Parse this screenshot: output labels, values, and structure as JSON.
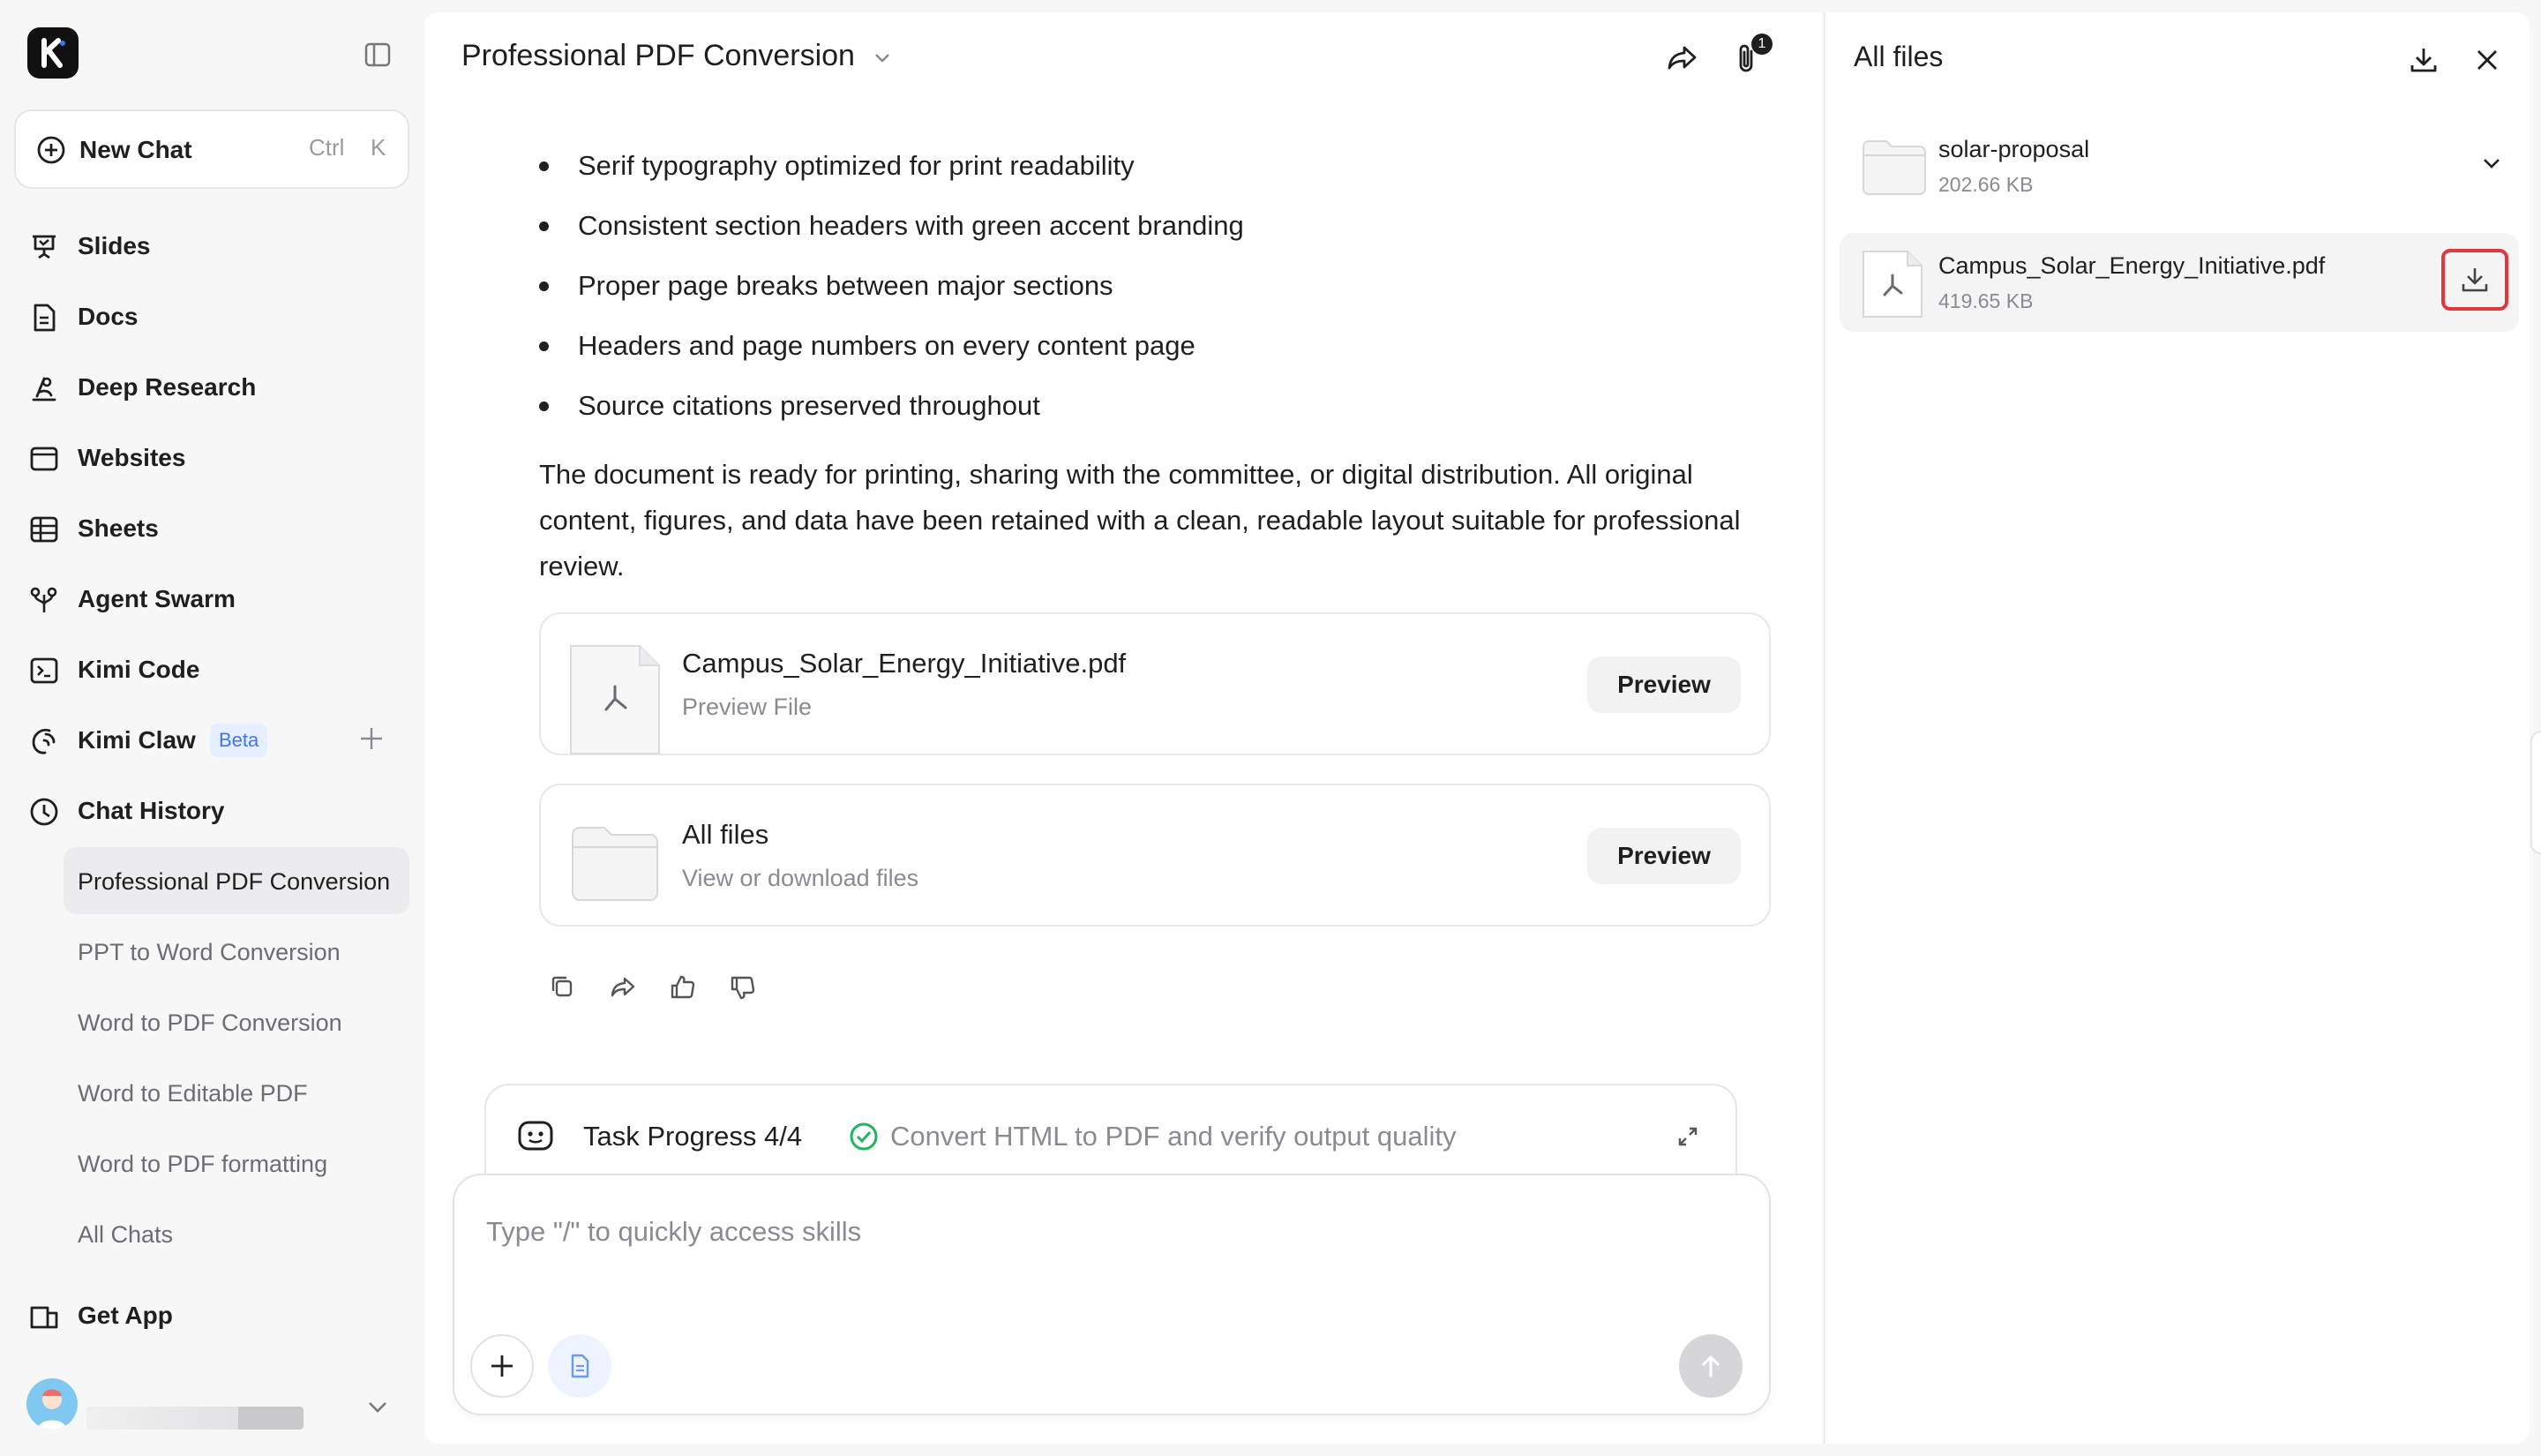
{
  "sidebar": {
    "new_chat": {
      "label": "New Chat",
      "shortcut_ctrl": "Ctrl",
      "shortcut_key": "K"
    },
    "nav": [
      {
        "label": "Slides",
        "icon": "slides-icon"
      },
      {
        "label": "Docs",
        "icon": "docs-icon"
      },
      {
        "label": "Deep Research",
        "icon": "deep-research-icon"
      },
      {
        "label": "Websites",
        "icon": "websites-icon"
      },
      {
        "label": "Sheets",
        "icon": "sheets-icon"
      },
      {
        "label": "Agent Swarm",
        "icon": "agent-swarm-icon"
      },
      {
        "label": "Kimi Code",
        "icon": "kimi-code-icon"
      },
      {
        "label": "Kimi Claw",
        "icon": "kimi-claw-icon",
        "badge": "Beta"
      },
      {
        "label": "Chat History",
        "icon": "clock-icon"
      }
    ],
    "history": [
      {
        "label": "Professional PDF Conversion",
        "active": true
      },
      {
        "label": "PPT to Word Conversion"
      },
      {
        "label": "Word to PDF Conversion"
      },
      {
        "label": "Word to Editable PDF"
      },
      {
        "label": "Word to PDF formatting"
      },
      {
        "label": "All Chats"
      }
    ],
    "get_app": "Get App"
  },
  "main": {
    "title": "Professional PDF Conversion",
    "attachment_count": "1",
    "bullets": [
      "Serif typography optimized for print readability",
      "Consistent section headers with green accent branding",
      "Proper page breaks between major sections",
      "Headers and page numbers on every content page",
      "Source citations preserved throughout"
    ],
    "paragraph": "The document is ready for printing, sharing with the committee, or digital distribution. All original content, figures, and data have been retained with a clean, readable layout suitable for professional review.",
    "cards": [
      {
        "name": "Campus_Solar_Energy_Initiative.pdf",
        "sub": "Preview File",
        "button": "Preview"
      },
      {
        "name": "All files",
        "sub": "View or download files",
        "button": "Preview"
      }
    ],
    "task_progress": {
      "label": "Task Progress 4/4",
      "status": "Convert HTML to PDF and verify output quality"
    },
    "composer": {
      "placeholder": "Type \"/\" to quickly access skills"
    }
  },
  "files_panel": {
    "title": "All files",
    "items": [
      {
        "name": "solar-proposal",
        "size": "202.66 KB",
        "type": "folder"
      },
      {
        "name": "Campus_Solar_Energy_Initiative.pdf",
        "size": "419.65 KB",
        "type": "pdf"
      }
    ]
  },
  "colors": {
    "accent_blue": "#3b76f6",
    "success_green": "#22b35e",
    "highlight_red": "#e0383e"
  }
}
